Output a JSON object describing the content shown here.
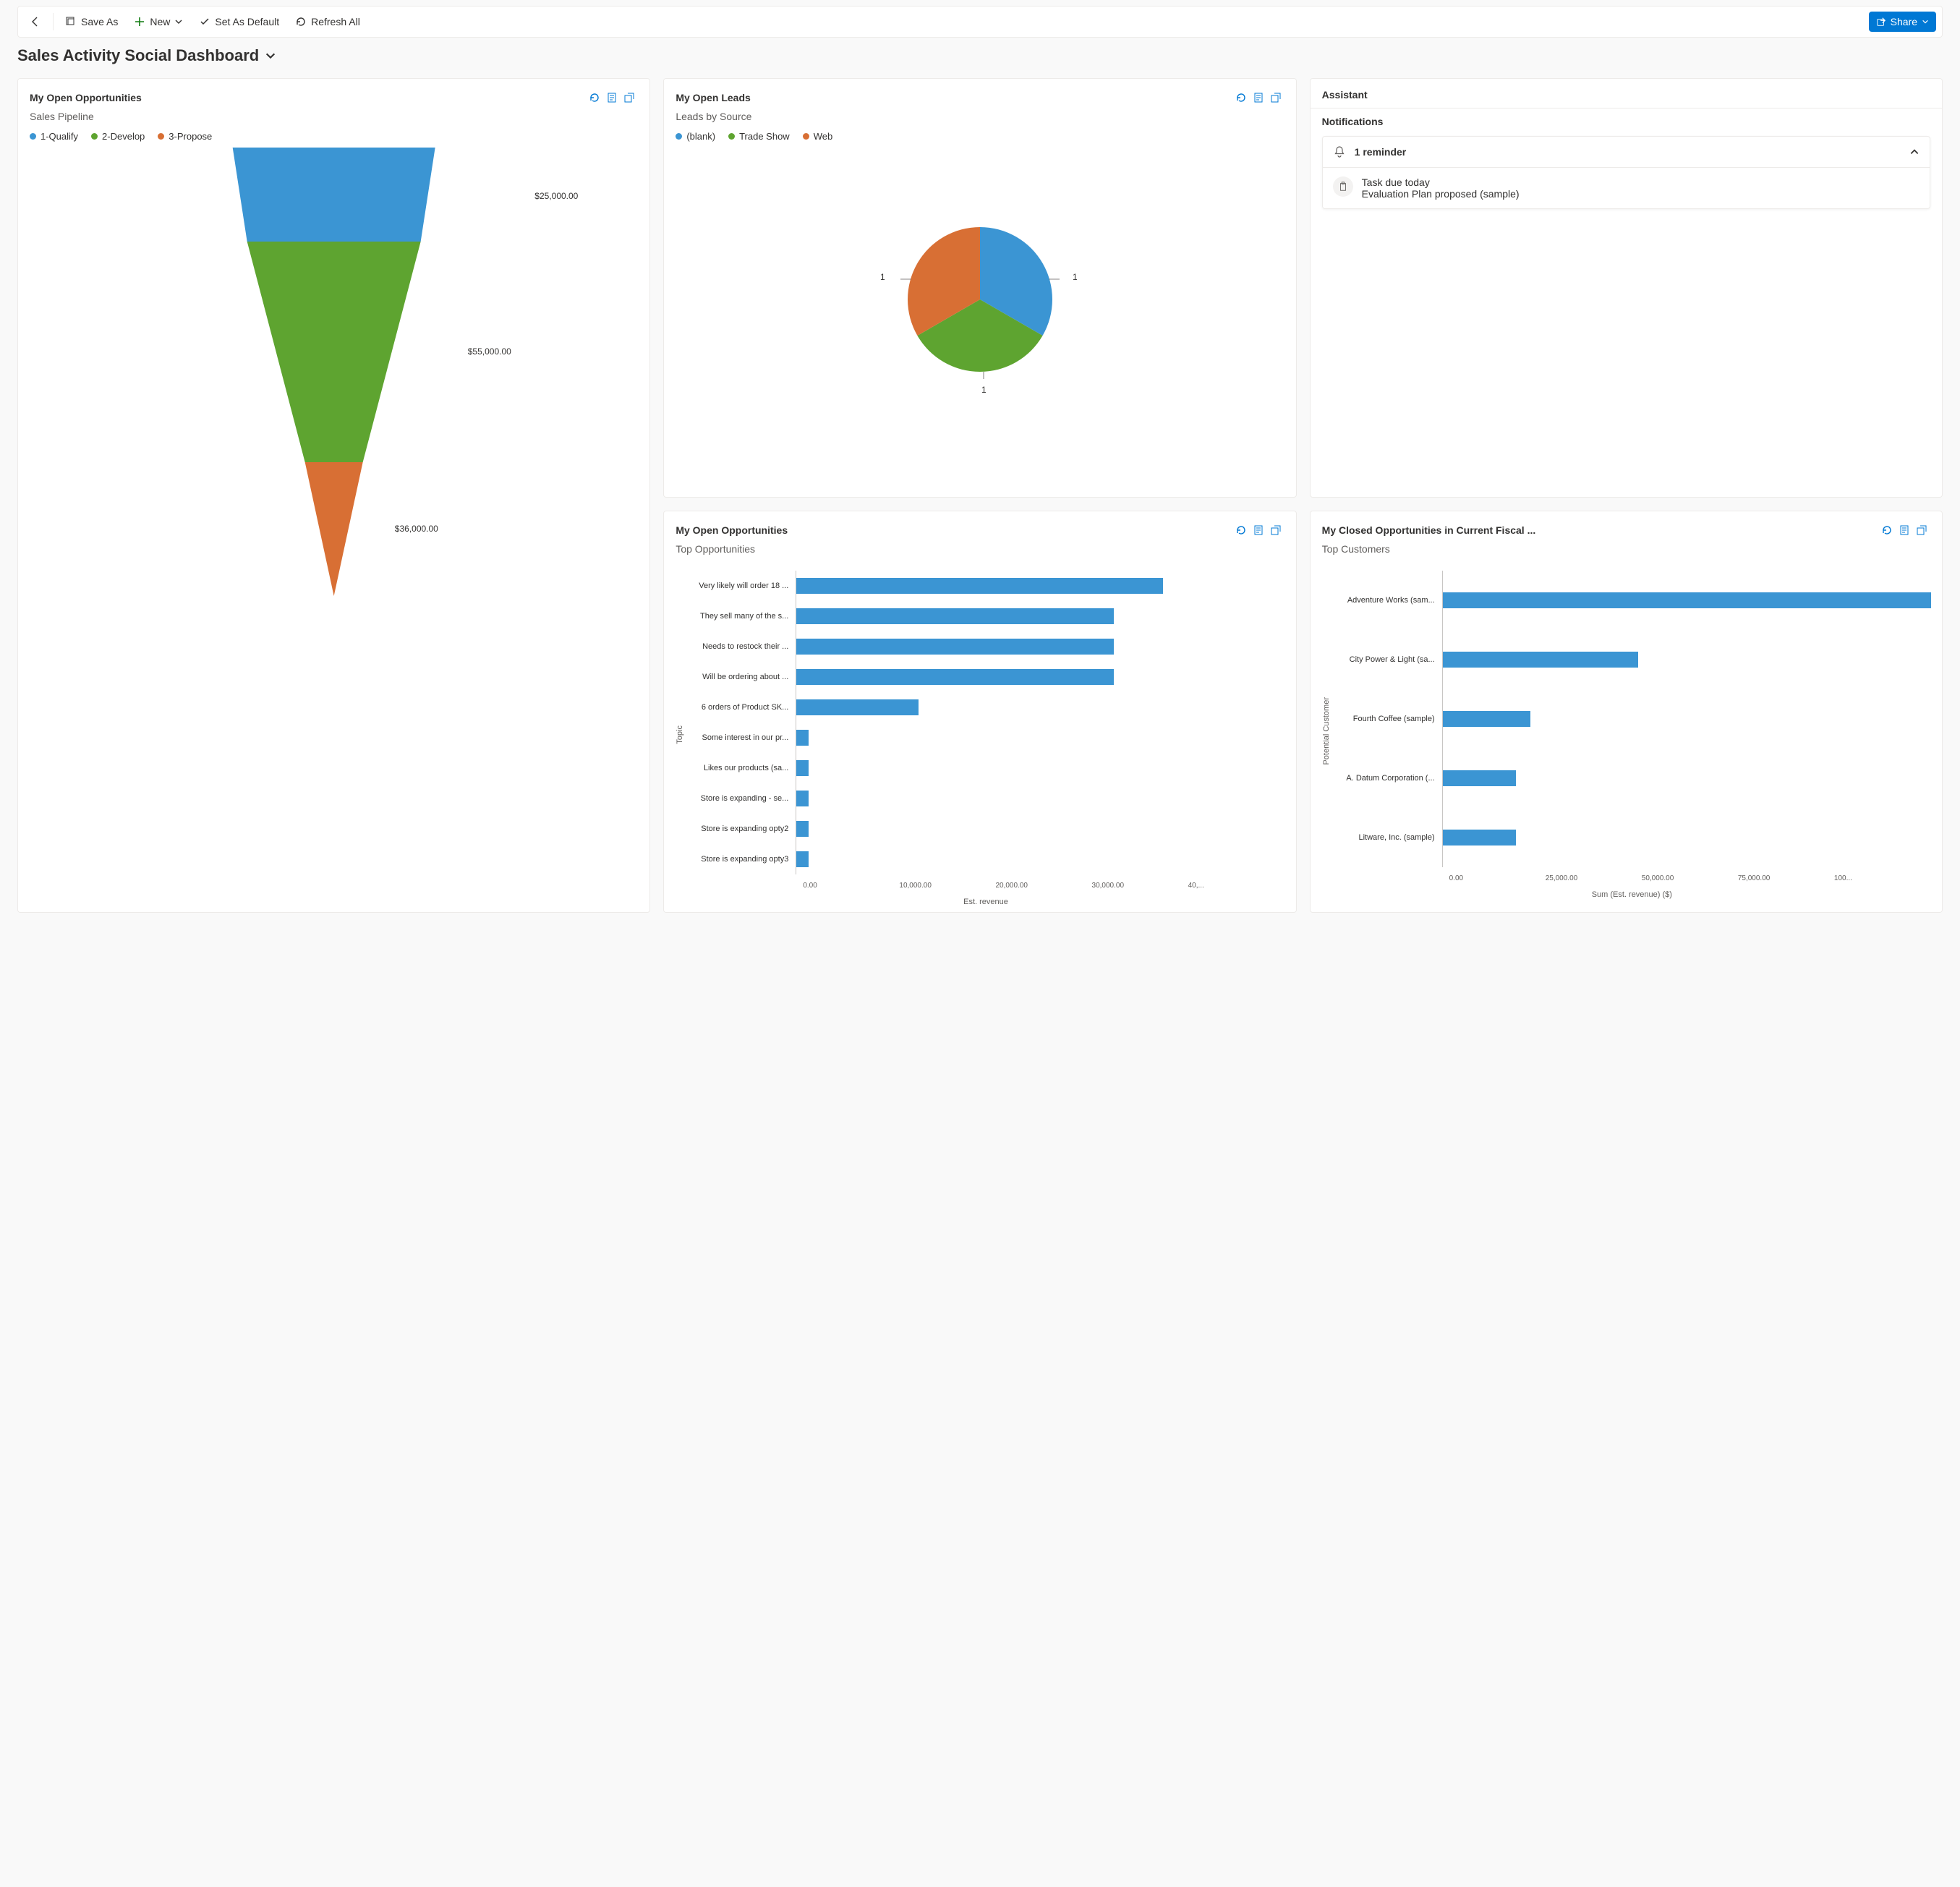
{
  "commands": {
    "save_as": "Save As",
    "new": "New",
    "set_default": "Set As Default",
    "refresh_all": "Refresh All",
    "share": "Share"
  },
  "page_title": "Sales Activity Social Dashboard",
  "cards": {
    "funnel": {
      "title": "My Open Opportunities",
      "subtitle": "Sales Pipeline",
      "legend": [
        {
          "label": "1-Qualify",
          "color": "#3b95d3"
        },
        {
          "label": "2-Develop",
          "color": "#5ea430"
        },
        {
          "label": "3-Propose",
          "color": "#d86f34"
        }
      ],
      "value_labels": [
        "$25,000.00",
        "$55,000.00",
        "$36,000.00"
      ]
    },
    "leads": {
      "title": "My Open Leads",
      "subtitle": "Leads by Source",
      "legend": [
        {
          "label": "(blank)",
          "color": "#3b95d3"
        },
        {
          "label": "Trade Show",
          "color": "#5ea430"
        },
        {
          "label": "Web",
          "color": "#d86f34"
        }
      ],
      "pie_labels": [
        "1",
        "1",
        "1"
      ]
    },
    "assistant": {
      "title": "Assistant",
      "notifications_title": "Notifications",
      "reminder_count": "1 reminder",
      "task_line1": "Task due today",
      "task_line2": "Evaluation Plan proposed (sample)"
    },
    "topopps": {
      "title": "My Open Opportunities",
      "subtitle": "Top Opportunities",
      "yaxis": "Topic",
      "xaxis": "Est. revenue",
      "xticks": [
        "0.00",
        "10,000.00",
        "20,000.00",
        "30,000.00",
        "40,..."
      ]
    },
    "closed": {
      "title": "My Closed Opportunities in Current Fiscal ...",
      "subtitle": "Top Customers",
      "yaxis": "Potential Customer",
      "xaxis": "Sum (Est. revenue) ($)",
      "xticks": [
        "0.00",
        "25,000.00",
        "50,000.00",
        "75,000.00",
        "100..."
      ]
    }
  },
  "chart_data": [
    {
      "type": "funnel",
      "title": "Sales Pipeline",
      "categories": [
        "1-Qualify",
        "2-Develop",
        "3-Propose"
      ],
      "values": [
        25000,
        55000,
        36000
      ],
      "colors": [
        "#3b95d3",
        "#5ea430",
        "#d86f34"
      ]
    },
    {
      "type": "pie",
      "title": "Leads by Source",
      "categories": [
        "(blank)",
        "Trade Show",
        "Web"
      ],
      "values": [
        1,
        1,
        1
      ],
      "colors": [
        "#3b95d3",
        "#5ea430",
        "#d86f34"
      ]
    },
    {
      "type": "bar",
      "orientation": "horizontal",
      "title": "Top Opportunities",
      "ylabel": "Topic",
      "xlabel": "Est. revenue",
      "xlim": [
        0,
        40000
      ],
      "categories": [
        "Very likely will order 18 ...",
        "They sell many of the s...",
        "Needs to restock their ...",
        "Will be ordering about ...",
        "6 orders of Product SK...",
        "Some interest in our pr...",
        "Likes our products (sa...",
        "Store is expanding - se...",
        "Store is expanding opty2",
        "Store is expanding opty3"
      ],
      "values": [
        30000,
        26000,
        26000,
        26000,
        10000,
        1000,
        1000,
        1000,
        1000,
        1000
      ]
    },
    {
      "type": "bar",
      "orientation": "horizontal",
      "title": "Top Customers",
      "ylabel": "Potential Customer",
      "xlabel": "Sum (Est. revenue) ($)",
      "xlim": [
        0,
        100000
      ],
      "categories": [
        "Adventure Works (sam...",
        "City Power & Light (sa...",
        "Fourth Coffee (sample)",
        "A. Datum Corporation (...",
        "Litware, Inc. (sample)"
      ],
      "values": [
        100000,
        40000,
        18000,
        15000,
        15000
      ]
    }
  ]
}
